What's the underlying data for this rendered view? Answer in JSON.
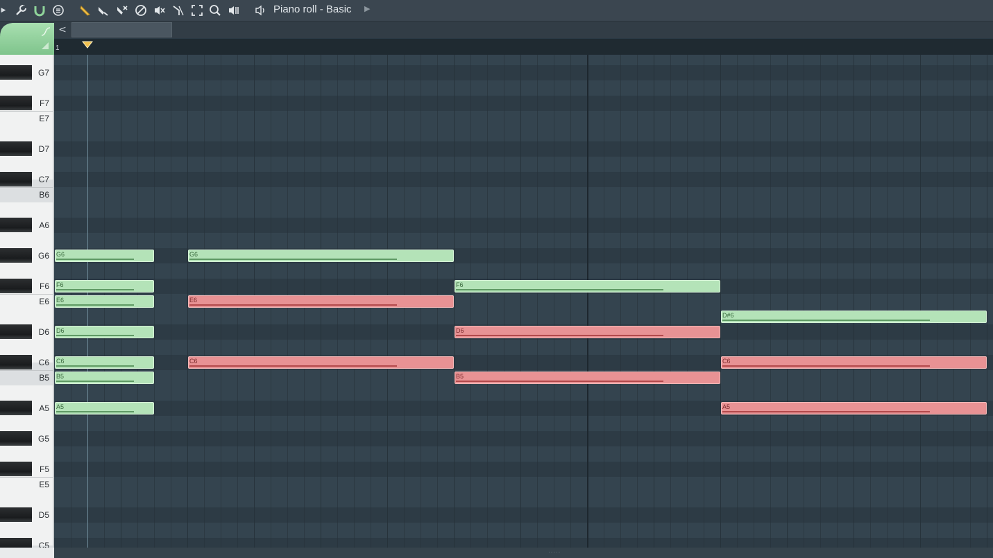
{
  "toolbar": {
    "title": "Piano roll - Basic",
    "icons": [
      "menu-arrow-icon",
      "wrench-icon",
      "magnet-icon",
      "menu-circle-icon",
      "pencil-icon",
      "paint-brush-icon",
      "delete-tool-icon",
      "mute-icon",
      "mute-speaker-icon",
      "slice-icon",
      "select-icon",
      "zoom-icon",
      "playback-icon",
      "speaker-icon"
    ]
  },
  "ruler": {
    "bar_label": "1"
  },
  "keyboard": {
    "labels": [
      {
        "key": "G7",
        "row": 1
      },
      {
        "key": "F7",
        "row": 3
      },
      {
        "key": "E7",
        "row": 4
      },
      {
        "key": "D7",
        "row": 6
      },
      {
        "key": "C7",
        "row": 8
      },
      {
        "key": "B6",
        "row": 9
      },
      {
        "key": "A6",
        "row": 11
      },
      {
        "key": "G6",
        "row": 13
      },
      {
        "key": "F6",
        "row": 15
      },
      {
        "key": "E6",
        "row": 16
      },
      {
        "key": "D6",
        "row": 18
      },
      {
        "key": "C6",
        "row": 20
      },
      {
        "key": "B5",
        "row": 21
      },
      {
        "key": "A5",
        "row": 23
      },
      {
        "key": "G5",
        "row": 25
      },
      {
        "key": "F5",
        "row": 27
      },
      {
        "key": "E5",
        "row": 28
      },
      {
        "key": "D5",
        "row": 30
      },
      {
        "key": "C5",
        "row": 32
      }
    ]
  },
  "notes": [
    {
      "label": "G6",
      "pitch_row": 13,
      "start": 0,
      "length": 6,
      "color": "green"
    },
    {
      "label": "F6",
      "pitch_row": 15,
      "start": 0,
      "length": 6,
      "color": "green"
    },
    {
      "label": "E6",
      "pitch_row": 16,
      "start": 0,
      "length": 6,
      "color": "green"
    },
    {
      "label": "D6",
      "pitch_row": 18,
      "start": 0,
      "length": 6,
      "color": "green"
    },
    {
      "label": "C6",
      "pitch_row": 20,
      "start": 0,
      "length": 6,
      "color": "green"
    },
    {
      "label": "B5",
      "pitch_row": 21,
      "start": 0,
      "length": 6,
      "color": "green"
    },
    {
      "label": "A5",
      "pitch_row": 23,
      "start": 0,
      "length": 6,
      "color": "green"
    },
    {
      "label": "G6",
      "pitch_row": 13,
      "start": 8,
      "length": 16,
      "color": "green"
    },
    {
      "label": "E6",
      "pitch_row": 16,
      "start": 8,
      "length": 16,
      "color": "red"
    },
    {
      "label": "C6",
      "pitch_row": 20,
      "start": 8,
      "length": 16,
      "color": "red"
    },
    {
      "label": "F6",
      "pitch_row": 15,
      "start": 24,
      "length": 16,
      "color": "green"
    },
    {
      "label": "D6",
      "pitch_row": 18,
      "start": 24,
      "length": 16,
      "color": "red"
    },
    {
      "label": "B5",
      "pitch_row": 21,
      "start": 24,
      "length": 16,
      "color": "red"
    },
    {
      "label": "D#6",
      "pitch_row": 17,
      "start": 40,
      "length": 16,
      "color": "green"
    },
    {
      "label": "C6",
      "pitch_row": 20,
      "start": 40,
      "length": 16,
      "color": "red"
    },
    {
      "label": "A5",
      "pitch_row": 23,
      "start": 40,
      "length": 16,
      "color": "red"
    }
  ],
  "colors": {
    "note_green": "#b4e3b8",
    "note_red": "#e89294",
    "grid_dark": "#2d3b45",
    "grid_light": "#34444f",
    "accent_green": "#8fd49a",
    "playhead_marker": "#f2c14e"
  }
}
